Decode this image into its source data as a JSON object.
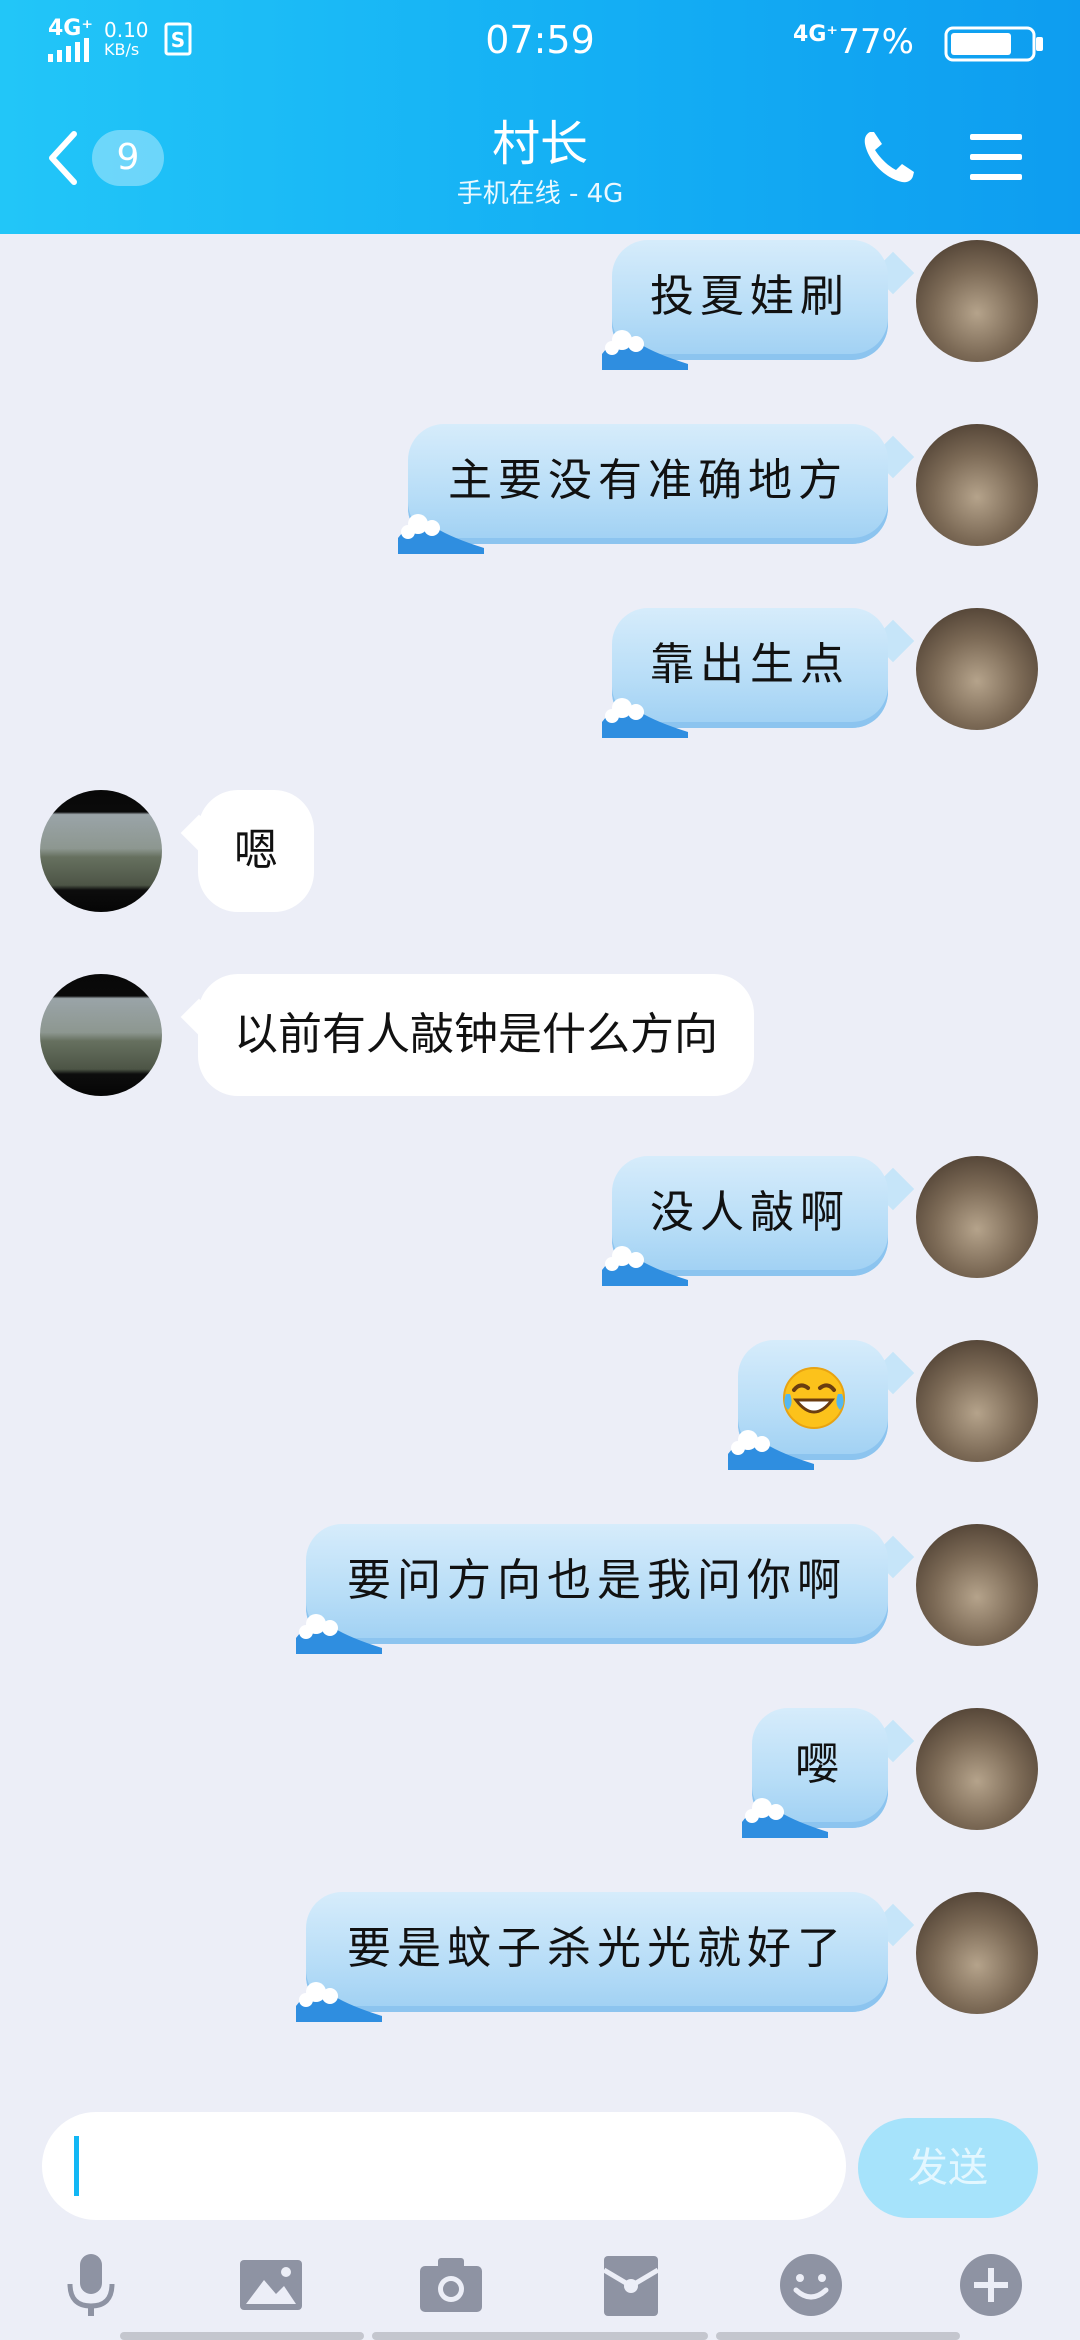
{
  "status_bar": {
    "left_network": "4G⁺",
    "net_speed": "0.10",
    "net_unit": "KB/s",
    "time": "07:59",
    "right_network": "4G⁺",
    "battery": "77%"
  },
  "nav": {
    "unread_count": "9",
    "title": "村长",
    "subtitle": "手机在线 - 4G",
    "icons": [
      "back-icon",
      "phone-icon",
      "menu-icon"
    ]
  },
  "messages": [
    {
      "side": "me",
      "text": "投夏娃刷"
    },
    {
      "side": "me",
      "text": "主要没有准确地方"
    },
    {
      "side": "me",
      "text": "靠出生点"
    },
    {
      "side": "other",
      "text": "嗯"
    },
    {
      "side": "other",
      "text": "以前有人敲钟是什么方向"
    },
    {
      "side": "me",
      "text": "没人敲啊"
    },
    {
      "side": "me",
      "text": "",
      "emoji": "tears-of-joy-emoji"
    },
    {
      "side": "me",
      "text": "要问方向也是我问你啊"
    },
    {
      "side": "me",
      "text": "嘤"
    },
    {
      "side": "me",
      "text": "要是蚊子杀光光就好了"
    }
  ],
  "composer": {
    "input_value": "",
    "send_label": "发送"
  },
  "toolbar": [
    "microphone-icon",
    "image-icon",
    "camera-icon",
    "red-packet-icon",
    "emoji-icon",
    "plus-icon"
  ],
  "colors": {
    "header": "#14aff4",
    "background": "#eceef7",
    "send_button": "#a6e3fb"
  }
}
